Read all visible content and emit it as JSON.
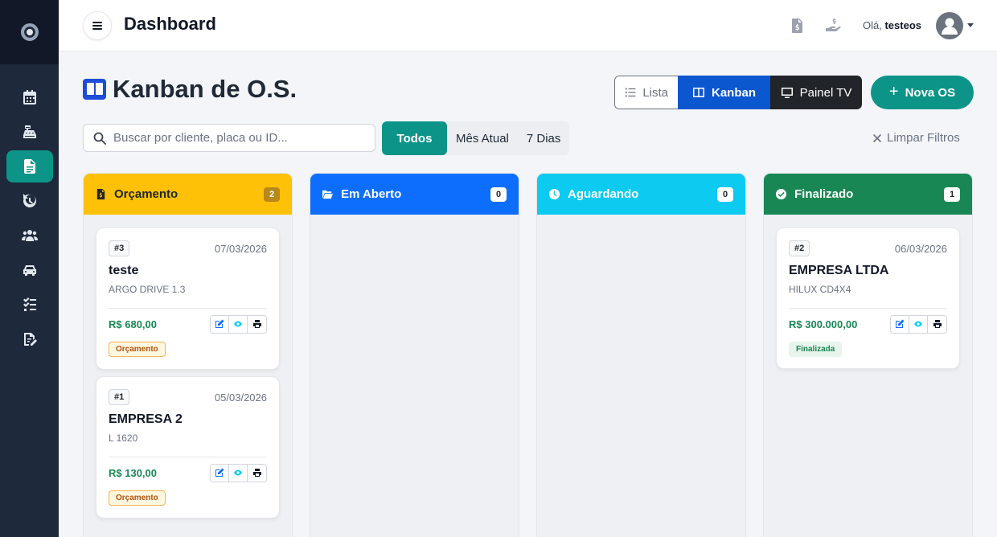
{
  "topbar": {
    "title": "Dashboard",
    "greeting_prefix": "Olá,",
    "username": "testeos"
  },
  "sidebar": {
    "items": [
      {
        "icon": "calendar-icon"
      },
      {
        "icon": "cash-register-icon"
      },
      {
        "icon": "document-icon",
        "active": true
      },
      {
        "icon": "history-icon"
      },
      {
        "icon": "users-icon"
      },
      {
        "icon": "car-icon"
      },
      {
        "icon": "checklist-icon"
      },
      {
        "icon": "signature-icon"
      }
    ]
  },
  "header": {
    "title": "Kanban de O.S.",
    "views": {
      "lista": "Lista",
      "kanban": "Kanban",
      "tv": "Painel TV"
    },
    "new_button": "Nova OS"
  },
  "filters": {
    "search_placeholder": "Buscar por cliente, placa ou ID...",
    "periods": [
      "Todos",
      "Mês Atual",
      "7 Dias"
    ],
    "active_period": "Todos",
    "clear_label": "Limpar Filtros"
  },
  "columns": [
    {
      "name": "Orçamento",
      "count": "2",
      "color": "#ffc107",
      "cards": [
        {
          "id": "#3",
          "date": "07/03/2026",
          "client": "teste",
          "vehicle": "ARGO DRIVE 1.3",
          "price": "R$ 680,00",
          "status": "Orçamento"
        },
        {
          "id": "#1",
          "date": "05/03/2026",
          "client": "EMPRESA 2",
          "vehicle": "L 1620",
          "price": "R$ 130,00",
          "status": "Orçamento"
        }
      ]
    },
    {
      "name": "Em Aberto",
      "count": "0",
      "color": "#0d6efd",
      "cards": []
    },
    {
      "name": "Aguardando",
      "count": "0",
      "color": "#0dcaf0",
      "cards": []
    },
    {
      "name": "Finalizado",
      "count": "1",
      "color": "#198754",
      "cards": [
        {
          "id": "#2",
          "date": "06/03/2026",
          "client": "EMPRESA LTDA",
          "vehicle": "HILUX CD4X4",
          "price": "R$ 300.000,00",
          "status": "Finalizada"
        }
      ]
    }
  ]
}
